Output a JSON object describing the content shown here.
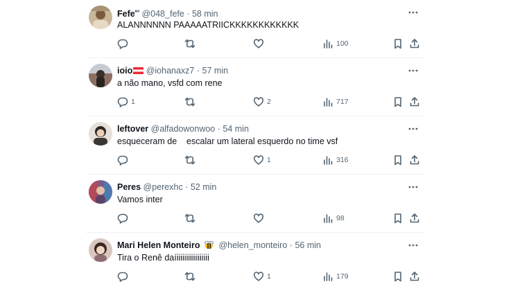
{
  "tweets": [
    {
      "name": "Fefe",
      "name_sup": "ᵉᶜᶦ",
      "handle": "@048_fefe",
      "separator": "·",
      "time": "58 min",
      "text": "ALANNNNNN PAAAAATRIICKKKKKKKKKKKK",
      "replies": "",
      "retweets": "",
      "likes": "",
      "views": "100"
    },
    {
      "name": "ioio",
      "handle": "@iohanaxz7",
      "separator": "·",
      "time": "57 min",
      "text": "a não mano, vsfd com rene",
      "replies": "1",
      "retweets": "",
      "likes": "2",
      "views": "717"
    },
    {
      "name": "leftover",
      "handle": "@alfadowonwoo",
      "separator": "·",
      "time": "54 min",
      "text": "esqueceram de    escalar um lateral esquerdo no time vsf",
      "replies": "",
      "retweets": "",
      "likes": "1",
      "views": "316"
    },
    {
      "name": "Peres",
      "handle": "@perexhc",
      "separator": "·",
      "time": "52 min",
      "text": "Vamos inter",
      "replies": "",
      "retweets": "",
      "likes": "",
      "views": "98"
    },
    {
      "name": "Mari Helen Monteiro",
      "handle": "@helen_monteiro",
      "separator": "·",
      "time": "56 min",
      "text": "Tira o Renê daíiiiiiiiiiiiiiiiii",
      "replies": "",
      "retweets": "",
      "likes": "1",
      "views": "179"
    }
  ],
  "colors": {
    "text": "#0f1419",
    "secondary": "#536471",
    "divider": "#eff3f4"
  },
  "icons": {
    "more": "more-horizontal-icon",
    "reply": "reply-icon",
    "retweet": "retweet-icon",
    "like": "heart-icon",
    "views": "bar-chart-icon",
    "bookmark": "bookmark-icon",
    "share": "share-icon"
  }
}
